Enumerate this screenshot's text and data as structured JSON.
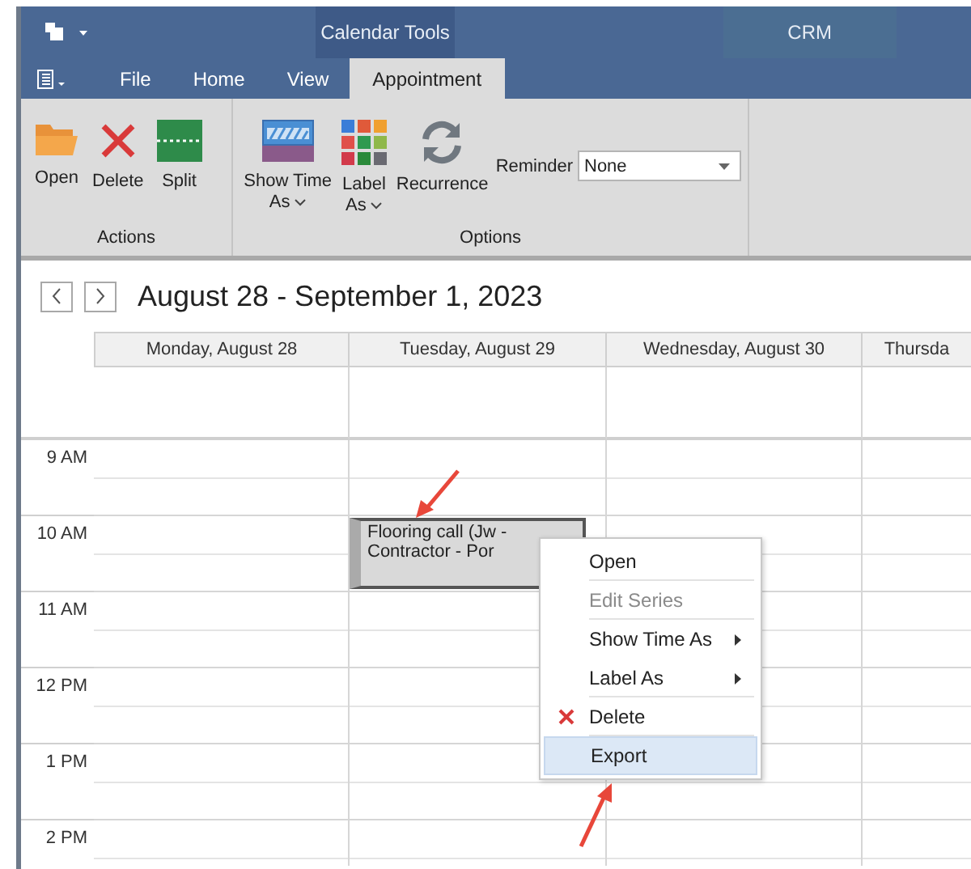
{
  "window": {
    "title": "CRM",
    "context_tab_group": "Calendar Tools"
  },
  "menu_tabs": [
    {
      "label": "File",
      "selected": false
    },
    {
      "label": "Home",
      "selected": false
    },
    {
      "label": "View",
      "selected": false
    },
    {
      "label": "Appointment",
      "selected": true
    }
  ],
  "ribbon": {
    "groups": [
      {
        "label": "Actions",
        "buttons": [
          {
            "label": "Open",
            "kind": "open",
            "dropdown": false
          },
          {
            "label": "Delete",
            "kind": "delete",
            "dropdown": false
          },
          {
            "label": "Split",
            "kind": "split",
            "dropdown": false
          }
        ]
      },
      {
        "label": "Options",
        "buttons": [
          {
            "label": "Show Time As",
            "kind": "show-time",
            "dropdown": true
          },
          {
            "label": "Label As",
            "kind": "label",
            "dropdown": true
          },
          {
            "label": "Recurrence",
            "kind": "recurrence",
            "dropdown": false
          }
        ],
        "reminder": {
          "label": "Reminder",
          "value": "None"
        }
      }
    ]
  },
  "calendar": {
    "range_title": "August 28 - September 1, 2023",
    "days": [
      "Monday, August 28",
      "Tuesday, August 29",
      "Wednesday, August 30",
      "Thursda"
    ],
    "time_slots": [
      {
        "label": "9 AM",
        "cells": [
          {},
          {},
          {},
          {}
        ]
      },
      {
        "label": "10 AM",
        "cells": [
          {},
          {
            "appointment": {
              "text": "Flooring call (Jw - Contractor - Por",
              "selected": true
            }
          },
          {},
          {}
        ]
      },
      {
        "label": "11 AM",
        "cells": [
          {},
          {},
          {},
          {}
        ]
      },
      {
        "label": "12 PM",
        "cells": [
          {},
          {},
          {},
          {}
        ]
      },
      {
        "label": "1 PM",
        "cells": [
          {},
          {},
          {},
          {}
        ]
      },
      {
        "label": "2 PM",
        "cells": [
          {},
          {},
          {},
          {}
        ]
      }
    ]
  },
  "context_menu": {
    "items": [
      {
        "label": "Open",
        "kind": "plain",
        "disabled": false,
        "submenu": false,
        "selected": false,
        "separator_after": true
      },
      {
        "label": "Edit Series",
        "kind": "plain",
        "disabled": true,
        "submenu": false,
        "selected": false,
        "separator_after": true
      },
      {
        "label": "Show Time As",
        "kind": "plain",
        "disabled": false,
        "submenu": true,
        "selected": false,
        "separator_after": false
      },
      {
        "label": "Label As",
        "kind": "plain",
        "disabled": false,
        "submenu": true,
        "selected": false,
        "separator_after": true
      },
      {
        "label": "Delete",
        "kind": "delete",
        "disabled": false,
        "submenu": false,
        "selected": false,
        "separator_after": true
      },
      {
        "label": "Export",
        "kind": "plain",
        "disabled": false,
        "submenu": false,
        "selected": true,
        "separator_after": false
      }
    ]
  }
}
